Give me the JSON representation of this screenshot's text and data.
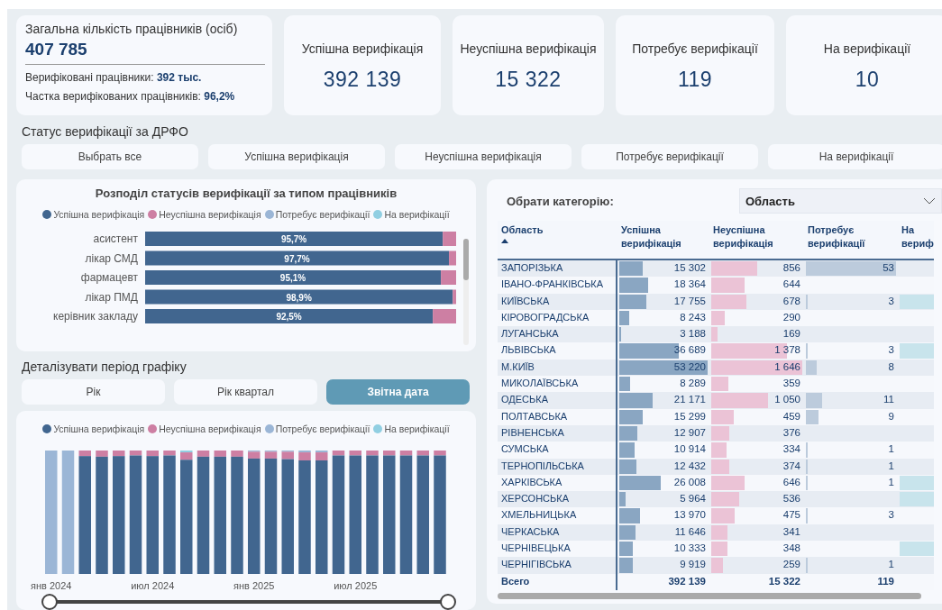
{
  "summary": {
    "title": "Загальна кількість працівників (осіб)",
    "total": "407 785",
    "verified_label": "Верифіковані працівники:",
    "verified_value": "392 тыс.",
    "share_label": "Частка верифікованих працівників:",
    "share_value": "96,2%"
  },
  "kpis": [
    {
      "label": "Успішна верифікація",
      "value": "392 139"
    },
    {
      "label": "Неуспішна верифікація",
      "value": "15 322"
    },
    {
      "label": "Потребує верифікації",
      "value": "119"
    },
    {
      "label": "На верифікації",
      "value": "10"
    }
  ],
  "status_filter": {
    "title": "Статус верифікації за ДРФО",
    "options": [
      {
        "label": "Выбрать все",
        "selected": false
      },
      {
        "label": "Успішна верифікація",
        "selected": false
      },
      {
        "label": "Неуспішна верифікація",
        "selected": false
      },
      {
        "label": "Потребує верифікації",
        "selected": false
      },
      {
        "label": "На верифікації",
        "selected": false
      }
    ]
  },
  "type_chart": {
    "chart_data": {
      "type": "bar",
      "title": "Розподіл статусів верифікації за типом працівників",
      "orientation": "horizontal",
      "stacked": true,
      "categories": [
        "асистент",
        "лікар СМД",
        "фармацевт",
        "лікар ПМД",
        "керівник закладу"
      ],
      "series": [
        {
          "name": "Успішна верифікація",
          "color": "#41668f",
          "values": [
            95.7,
            97.7,
            95.1,
            98.9,
            92.5
          ],
          "value_labels": [
            "95,7%",
            "97,7%",
            "95,1%",
            "98,9%",
            "92,5%"
          ]
        },
        {
          "name": "Неуспішна верифікація",
          "color": "#cd7fa3",
          "values": [
            4.3,
            2.3,
            4.9,
            1.1,
            7.5
          ],
          "value_labels": [
            null,
            null,
            null,
            null,
            null
          ]
        },
        {
          "name": "Потребує верифікації",
          "color": "#9bb6d6",
          "values": [
            0,
            0,
            0,
            0,
            0
          ],
          "value_labels": [
            null,
            null,
            null,
            null,
            null
          ]
        },
        {
          "name": "На верифікації",
          "color": "#91cfe2",
          "values": [
            0,
            0,
            0,
            0,
            0
          ],
          "value_labels": [
            null,
            null,
            null,
            null,
            null
          ]
        }
      ]
    }
  },
  "period": {
    "title": "Деталізувати період графіку",
    "options": [
      {
        "label": "Рік",
        "selected": false
      },
      {
        "label": "Рік квартал",
        "selected": false
      },
      {
        "label": "Звітна дата",
        "selected": true
      }
    ]
  },
  "timeline": {
    "legend": [
      {
        "label": "Успішна верифікація",
        "color": "#41668f"
      },
      {
        "label": "Неуспішна верифікація",
        "color": "#cd7fa3"
      },
      {
        "label": "Потребує верифікації",
        "color": "#9bb6d6"
      },
      {
        "label": "На верифікації",
        "color": "#91cfe2"
      }
    ],
    "axis_labels": [
      "янв 2024",
      "июл 2024",
      "янв 2025",
      "июл 2025"
    ],
    "range": [
      {
        "level": 0
      },
      {
        "level": 1
      }
    ]
  },
  "table_panel": {
    "category_label": "Обрати категорію:",
    "category_value": "Область",
    "columns": [
      {
        "label": "Область",
        "sorted": true
      },
      {
        "label": "Успішна верифікація",
        "sorted": false
      },
      {
        "label": "Неуспішна верифікація",
        "sorted": false
      },
      {
        "label": "Потребує верифікації",
        "sorted": false
      },
      {
        "label": "На вериф",
        "sorted": false
      }
    ],
    "rows": [
      {
        "region": "ЗАПОРІЗЬКА",
        "success": {
          "text": "15 302",
          "level": 0.29
        },
        "failed": {
          "text": "856",
          "level": 0.52
        },
        "pending": {
          "text": "53",
          "level": 1
        }
      },
      {
        "region": "ІВАНО-ФРАНКІВСЬКА",
        "success": {
          "text": "18 364",
          "level": 0.35
        },
        "failed": {
          "text": "644",
          "level": 0.39
        }
      },
      {
        "region": "КИЇВСЬКА",
        "success": {
          "text": "17 755",
          "level": 0.33
        },
        "failed": {
          "text": "678",
          "level": 0.41
        },
        "pending": {
          "text": "3",
          "level": 0.06
        },
        "on_verification": {
          "level": 1
        }
      },
      {
        "region": "КІРОВОГРАДСЬКА",
        "success": {
          "text": "8 243",
          "level": 0.15
        },
        "failed": {
          "text": "290",
          "level": 0.18
        }
      },
      {
        "region": "ЛУГАНСЬКА",
        "success": {
          "text": "3 188",
          "level": 0.06
        },
        "failed": {
          "text": "169",
          "level": 0.1
        }
      },
      {
        "region": "ЛЬВІВСЬКА",
        "success": {
          "text": "36 689",
          "level": 0.69
        },
        "failed": {
          "text": "1 378",
          "level": 0.84
        },
        "pending": {
          "text": "3",
          "level": 0.06
        },
        "on_verification": {
          "level": 1
        }
      },
      {
        "region": "М.КИЇВ",
        "success": {
          "text": "53 220",
          "level": 1
        },
        "failed": {
          "text": "1 646",
          "level": 1
        },
        "pending": {
          "text": "8",
          "level": 0.15
        }
      },
      {
        "region": "МИКОЛАЇВСЬКА",
        "success": {
          "text": "8 289",
          "level": 0.16
        },
        "failed": {
          "text": "359",
          "level": 0.22
        }
      },
      {
        "region": "ОДЕСЬКА",
        "success": {
          "text": "21 171",
          "level": 0.4
        },
        "failed": {
          "text": "1 050",
          "level": 0.64
        },
        "pending": {
          "text": "11",
          "level": 0.21
        }
      },
      {
        "region": "ПОЛТАВСЬКА",
        "success": {
          "text": "15 299",
          "level": 0.29
        },
        "failed": {
          "text": "459",
          "level": 0.28
        },
        "pending": {
          "text": "9",
          "level": 0.17
        }
      },
      {
        "region": "РІВНЕНСЬКА",
        "success": {
          "text": "12 907",
          "level": 0.24
        },
        "failed": {
          "text": "376",
          "level": 0.23
        }
      },
      {
        "region": "СУМСЬКА",
        "success": {
          "text": "10 914",
          "level": 0.21
        },
        "failed": {
          "text": "334",
          "level": 0.2
        },
        "pending": {
          "text": "1",
          "level": 0.02
        }
      },
      {
        "region": "ТЕРНОПІЛЬСЬКА",
        "success": {
          "text": "12 432",
          "level": 0.23
        },
        "failed": {
          "text": "374",
          "level": 0.23
        },
        "pending": {
          "text": "1",
          "level": 0.02
        }
      },
      {
        "region": "ХАРКІВСЬКА",
        "success": {
          "text": "26 008",
          "level": 0.49
        },
        "failed": {
          "text": "646",
          "level": 0.39
        },
        "pending": {
          "text": "1",
          "level": 0.02
        },
        "on_verification": {
          "level": 1
        }
      },
      {
        "region": "ХЕРСОНСЬКА",
        "success": {
          "text": "5 964",
          "level": 0.11
        },
        "failed": {
          "text": "536",
          "level": 0.33
        },
        "on_verification": {
          "level": 1
        }
      },
      {
        "region": "ХМЕЛЬНИЦЬКА",
        "success": {
          "text": "13 970",
          "level": 0.26
        },
        "failed": {
          "text": "475",
          "level": 0.29
        },
        "pending": {
          "text": "3",
          "level": 0.06
        }
      },
      {
        "region": "ЧЕРКАСЬКА",
        "success": {
          "text": "11 646",
          "level": 0.22
        },
        "failed": {
          "text": "341",
          "level": 0.21
        }
      },
      {
        "region": "ЧЕРНІВЕЦЬКА",
        "success": {
          "text": "10 333",
          "level": 0.19
        },
        "failed": {
          "text": "348",
          "level": 0.21
        },
        "on_verification": {
          "level": 1
        }
      },
      {
        "region": "ЧЕРНІГІВСЬКА",
        "success": {
          "text": "9 919",
          "level": 0.19
        },
        "failed": {
          "text": "259",
          "level": 0.16
        },
        "pending": {
          "text": "1",
          "level": 0.02
        }
      }
    ],
    "total": {
      "label": "Всего",
      "success": "392 139",
      "failed": "15 322",
      "pending": "119"
    }
  }
}
